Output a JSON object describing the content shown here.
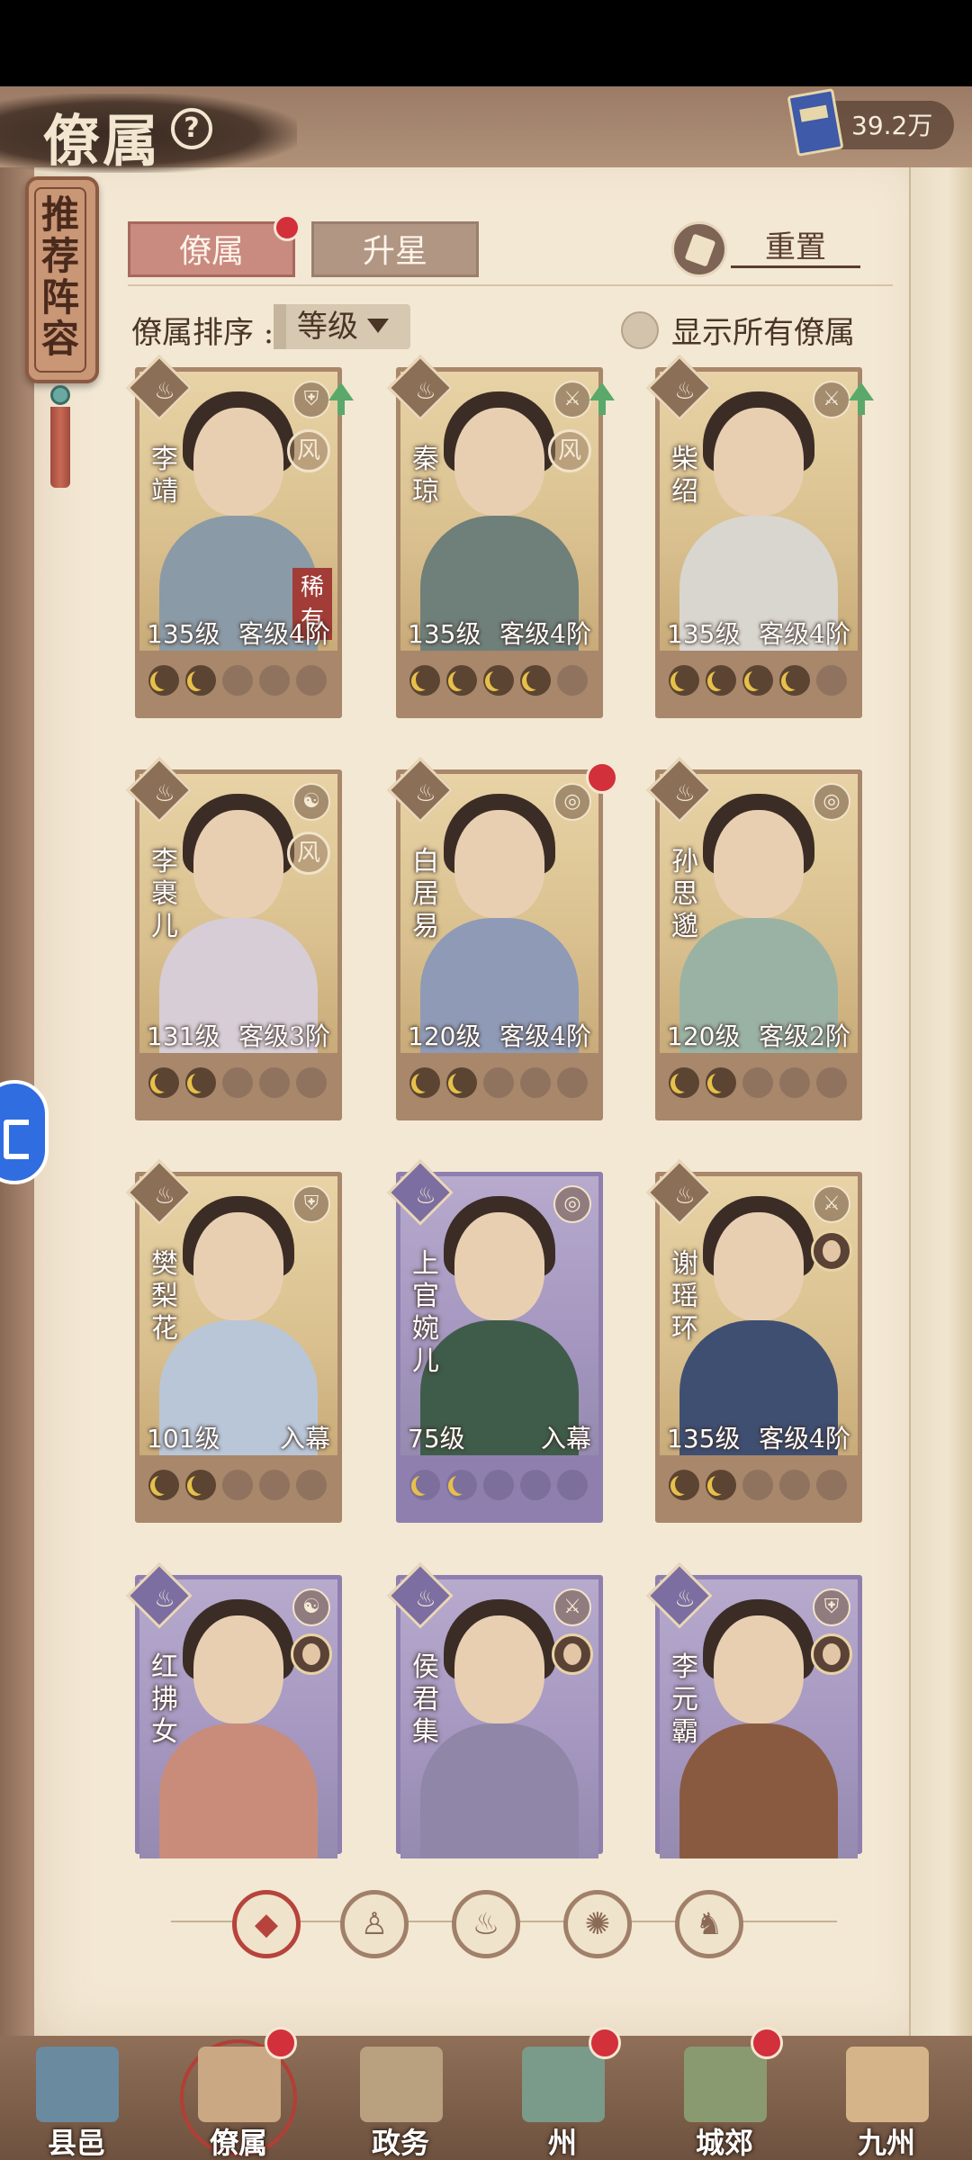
{
  "header": {
    "title": "僚属",
    "help": "?",
    "currency_value": "39.2万"
  },
  "side_tab": {
    "label": "推荐阵容"
  },
  "tabs": [
    {
      "label": "僚属"
    },
    {
      "label": "升星"
    }
  ],
  "reset": {
    "label": "重置"
  },
  "sort": {
    "label": "僚属排序 :",
    "selected": "等级"
  },
  "toggle": {
    "label": "显示所有僚属"
  },
  "cards": [
    {
      "name": "李靖",
      "level": "135级",
      "rank": "客级4阶",
      "type_icon": "shield-icon",
      "tag": "风",
      "rare": "稀有",
      "upgrade": true,
      "stars": 2,
      "rarity": "gold"
    },
    {
      "name": "秦琼",
      "level": "135级",
      "rank": "客级4阶",
      "type_icon": "sword-icon",
      "tag": "风",
      "upgrade": true,
      "stars": 4,
      "rarity": "gold"
    },
    {
      "name": "柴绍",
      "level": "135级",
      "rank": "客级4阶",
      "type_icon": "sword-icon",
      "upgrade": true,
      "stars": 4,
      "rarity": "gold"
    },
    {
      "name": "李裹儿",
      "level": "131级",
      "rank": "客级3阶",
      "type_icon": "yinyang-icon",
      "tag": "风",
      "stars": 2,
      "rarity": "gold"
    },
    {
      "name": "白居易",
      "level": "120级",
      "rank": "客级4阶",
      "type_icon": "coin-icon",
      "stars": 2,
      "rarity": "gold",
      "red_dot": true
    },
    {
      "name": "孙思邈",
      "level": "120级",
      "rank": "客级2阶",
      "type_icon": "coin-icon",
      "stars": 2,
      "rarity": "gold"
    },
    {
      "name": "樊梨花",
      "level": "101级",
      "rank": "入幕",
      "type_icon": "shield-icon",
      "stars": 2,
      "rarity": "gold"
    },
    {
      "name": "上官婉儿",
      "level": "75级",
      "rank": "入幕",
      "type_icon": "coin-icon",
      "stars": 2,
      "rarity": "purple"
    },
    {
      "name": "谢瑶环",
      "level": "135级",
      "rank": "客级4阶",
      "type_icon": "sword-icon",
      "avatar": true,
      "stars": 2,
      "rarity": "gold"
    },
    {
      "name": "红拂女",
      "type_icon": "yinyang-icon",
      "avatar": true,
      "rarity": "purple"
    },
    {
      "name": "侯君集",
      "type_icon": "sword-icon",
      "avatar": true,
      "rarity": "purple"
    },
    {
      "name": "李元霸",
      "type_icon": "shield-icon",
      "avatar": true,
      "rarity": "purple"
    }
  ],
  "filters": [
    {
      "name": "all",
      "glyph": "◆"
    },
    {
      "name": "bell",
      "glyph": "♙"
    },
    {
      "name": "gourd",
      "glyph": "♨"
    },
    {
      "name": "fan",
      "glyph": "✺"
    },
    {
      "name": "beast",
      "glyph": "♞"
    }
  ],
  "bottom_nav": [
    {
      "label": "县邑"
    },
    {
      "label": "僚属",
      "active": true,
      "red_dot": true
    },
    {
      "label": "政务"
    },
    {
      "label": "州",
      "red_dot": true
    },
    {
      "label": "城郊",
      "red_dot": true
    },
    {
      "label": "九州"
    }
  ],
  "colors": {
    "accent_red": "#d2303a",
    "gold_frame": "#a8876b",
    "purple_frame": "#8f7fae",
    "parchment": "#f3e8d4"
  }
}
